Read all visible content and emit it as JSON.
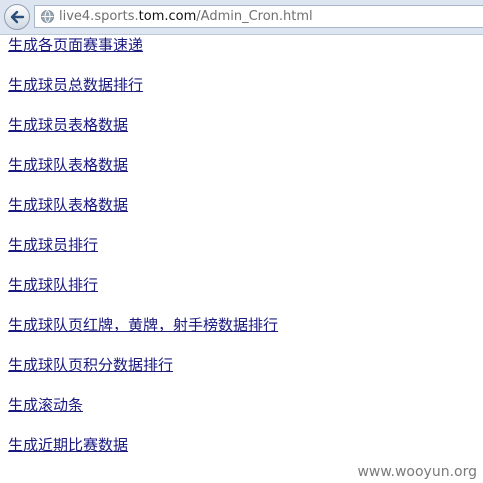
{
  "browser": {
    "url_prefix": "live4.sports.",
    "url_domain": "tom.com",
    "url_path": "/Admin_Cron.html"
  },
  "links": [
    "生成各页面赛事速递",
    "生成球员总数据排行",
    "生成球员表格数据",
    "生成球队表格数据",
    "生成球队表格数据",
    "生成球员排行",
    "生成球队排行",
    "生成球队页红牌，黄牌，射手榜数据排行",
    "生成球队页积分数据排行",
    "生成滚动条",
    "生成近期比赛数据"
  ],
  "watermark": "www.wooyun.org",
  "colors": {
    "link": "#1a1a80",
    "address_bar_bg": "#dde6f0"
  }
}
